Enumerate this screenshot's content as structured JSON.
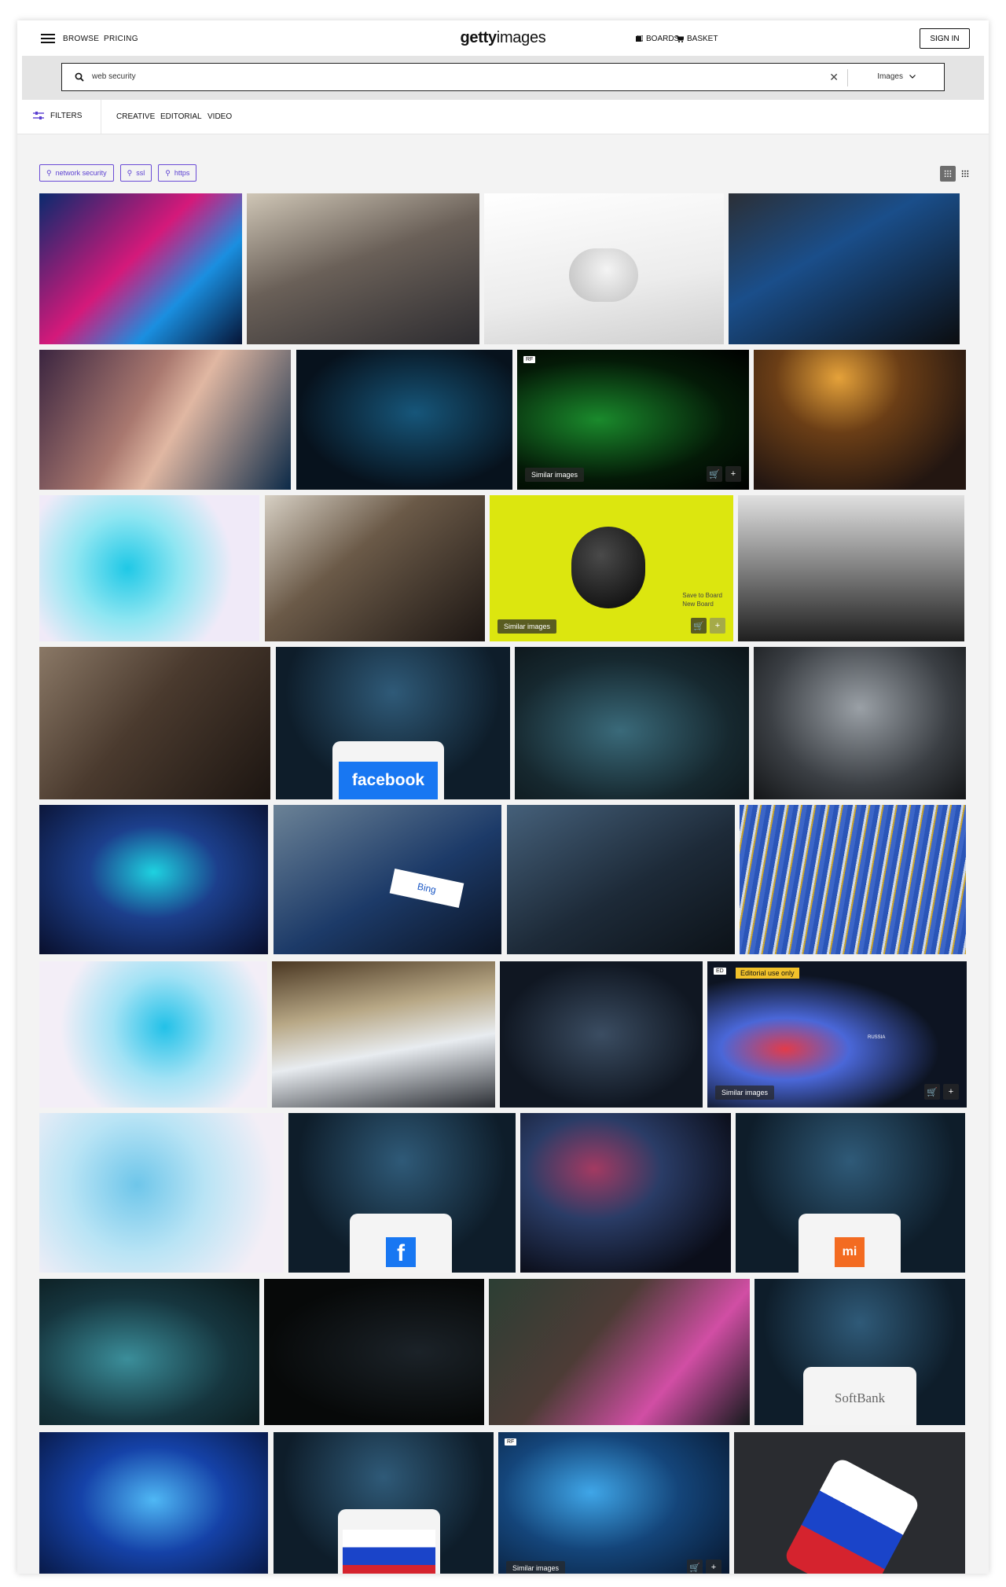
{
  "header": {
    "nav": [
      "BROWSE",
      "PRICING"
    ],
    "logo_bold": "getty",
    "logo_light": "images",
    "boards": "BOARDS",
    "basket": "BASKET",
    "sign_in": "SIGN IN"
  },
  "search": {
    "query": "web security",
    "type": "Images"
  },
  "filters": {
    "label": "FILTERS",
    "tabs": [
      "CREATIVE",
      "EDITORIAL",
      "VIDEO"
    ]
  },
  "chips": [
    "network security",
    "ssl",
    "https"
  ],
  "overlays": {
    "similar": "Similar images",
    "save_to_board": "Save to Board",
    "new_board": "New Board",
    "editorial_only": "Editorial use only",
    "rf": "RF",
    "ed": "ED",
    "facebook": "facebook",
    "bing": "Bing",
    "softbank": "SoftBank",
    "russia": "RUSSIA"
  },
  "colors": {
    "accent": "#5a3fd1",
    "editorial": "#f2c22a",
    "grid_bg": "#f3f3f3"
  }
}
